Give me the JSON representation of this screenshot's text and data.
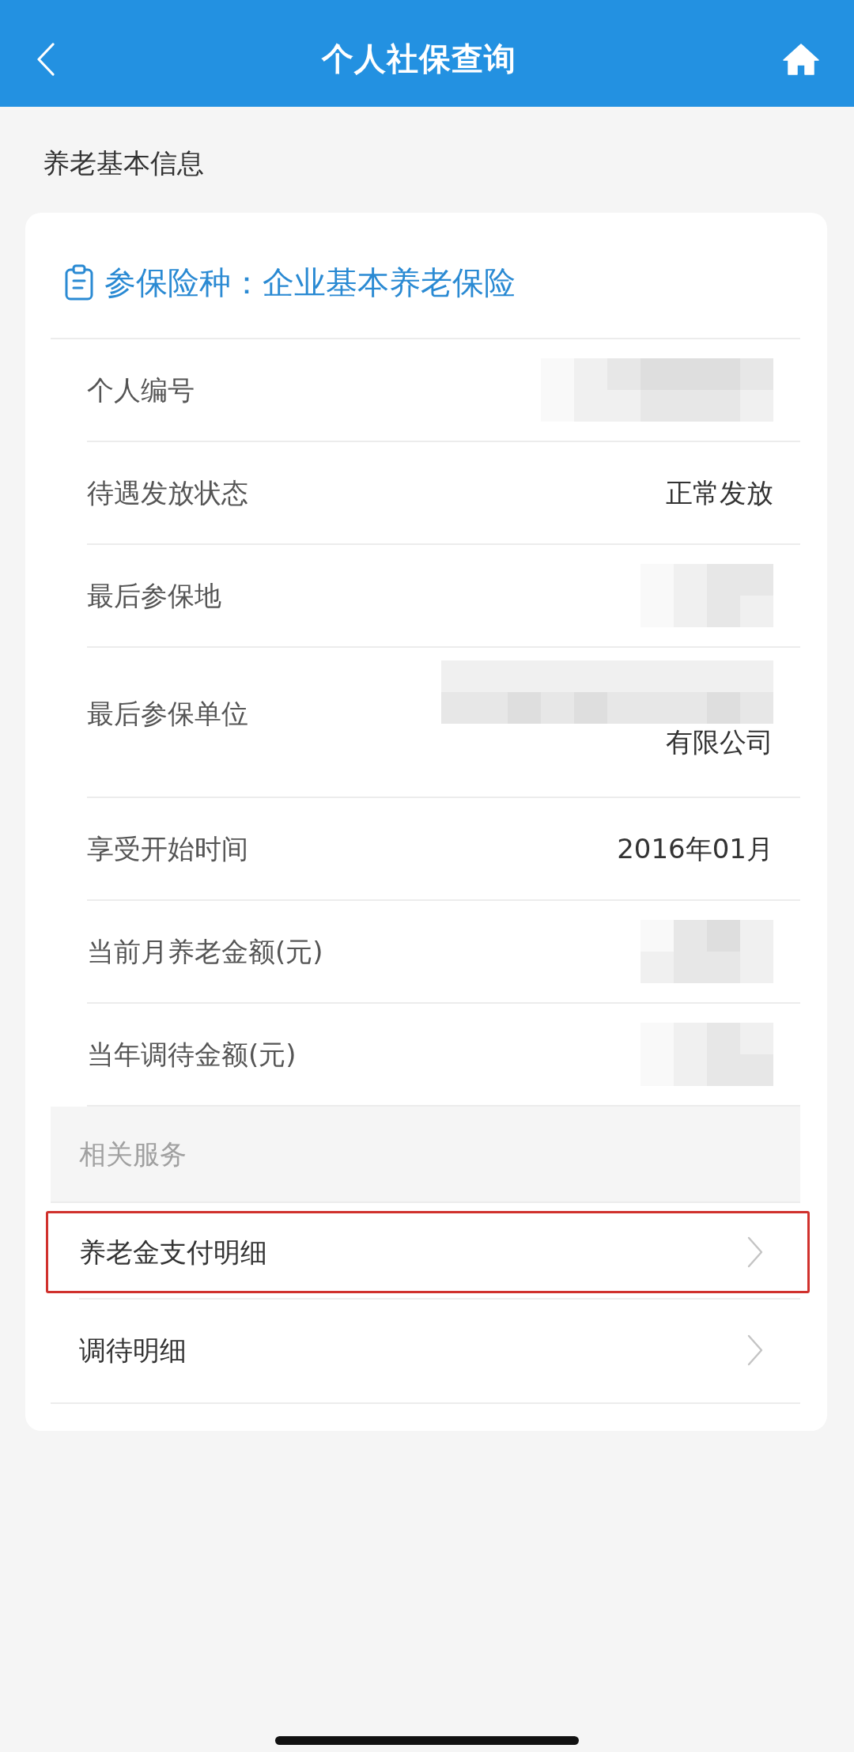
{
  "header": {
    "title": "个人社保查询"
  },
  "section_title": "养老基本信息",
  "card": {
    "insurance_type": "参保险种：企业基本养老保险",
    "rows": [
      {
        "label": "个人编号",
        "kind": "masked"
      },
      {
        "label": "待遇发放状态",
        "kind": "text",
        "value": "正常发放"
      },
      {
        "label": "最后参保地",
        "kind": "masked"
      },
      {
        "label": "最后参保单位",
        "kind": "masked",
        "value": "有限公司"
      },
      {
        "label": "享受开始时间",
        "kind": "text",
        "value": "2016年01月"
      },
      {
        "label": "当前月养老金额(元)",
        "kind": "masked"
      },
      {
        "label": "当年调待金额(元)",
        "kind": "masked"
      }
    ],
    "services": {
      "title": "相关服务",
      "items": [
        {
          "label": "养老金支付明细",
          "highlighted": true
        },
        {
          "label": "调待明细",
          "highlighted": false
        }
      ]
    }
  }
}
